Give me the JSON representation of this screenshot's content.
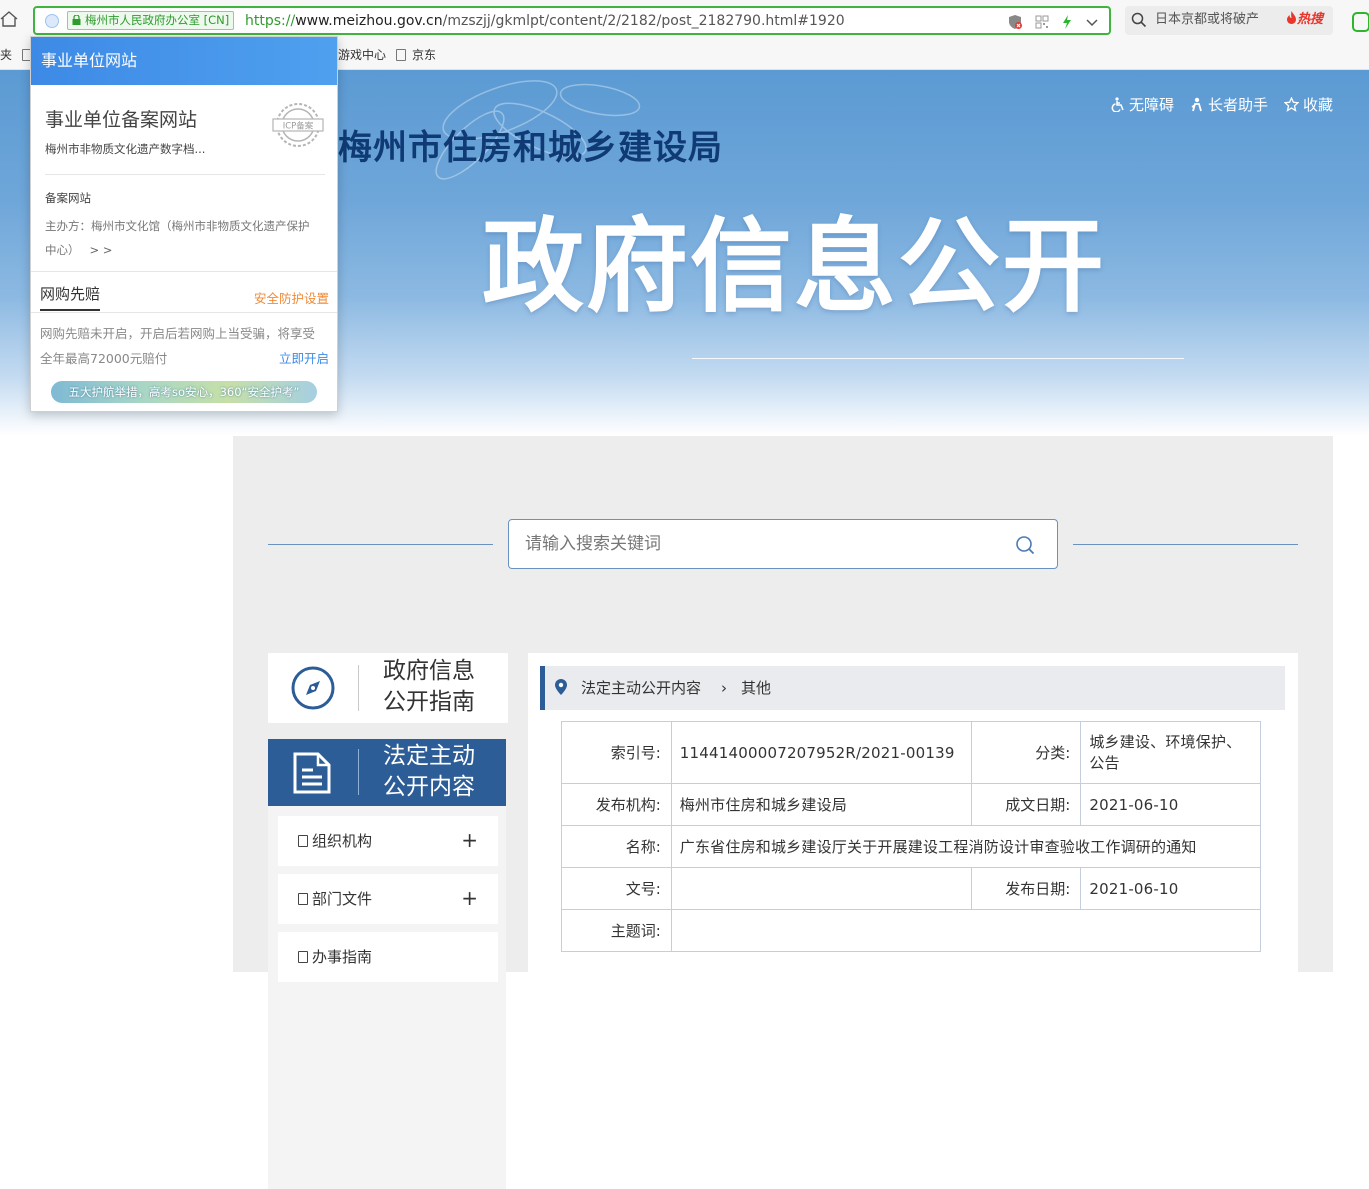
{
  "browser": {
    "address_bar": {
      "cert_label": "梅州市人民政府办公室 [CN]",
      "url_scheme": "https://",
      "url_domain": "www.meizhou.gov.cn",
      "url_path": "/mzszjj/gkmlpt/content/2/2182/post_2182790.html#1920"
    },
    "search_box": {
      "query": "日本京都或将破产",
      "hot_label": "热搜"
    },
    "bookmarks": [
      {
        "label": "夹"
      },
      {
        "label": "游戏中心"
      },
      {
        "label": "京东"
      }
    ]
  },
  "popup": {
    "header": "事业单位网站",
    "title": "事业单位备案网站",
    "subtitle": "梅州市非物质文化遗产数字档...",
    "stamp_text": "ICP备案",
    "section_label": "备案网站",
    "organizer_line1": "主办方：梅州市文化馆（梅州市非物质文化遗产保护",
    "organizer_line2": "中心）",
    "more": "> >",
    "tab_label": "网购先赔",
    "settings_link": "安全防护设置",
    "desc_line1": "网购先赔未开启，开启后若网购上当受骗，将享受",
    "desc_line2": "全年最高72000元赔付",
    "enable_link": "立即开启",
    "banner_text": "五大护航举措，高考so安心，360“安全护考”"
  },
  "hero": {
    "site_title": "梅州市住房和城乡建设局",
    "banner_title": "政府信息公开",
    "links": [
      {
        "label": "无障碍"
      },
      {
        "label": "长者助手"
      },
      {
        "label": "收藏"
      }
    ]
  },
  "search": {
    "placeholder": "请输入搜索关键词"
  },
  "sidebar": {
    "guide": {
      "line1": "政府信息",
      "line2": "公开指南"
    },
    "active": {
      "line1": "法定主动",
      "line2": "公开内容"
    },
    "items": [
      {
        "label": "组织机构",
        "toggle": "+"
      },
      {
        "label": "部门文件",
        "toggle": "+"
      },
      {
        "label": "办事指南"
      }
    ]
  },
  "breadcrumb": {
    "level1": "法定主动公开内容",
    "separator": "›",
    "level2": "其他"
  },
  "doc_info": {
    "index_no_label": "索引号:",
    "index_no": "11441400007207952R/2021-00139",
    "category_label": "分类:",
    "category_line1": "城乡建设、环境保护、",
    "category_line2": "公告",
    "publisher_label": "发布机构:",
    "publisher": "梅州市住房和城乡建设局",
    "created_label": "成文日期:",
    "created": "2021-06-10",
    "name_label": "名称:",
    "name": "广东省住房和城乡建设厅关于开展建设工程消防设计审查验收工作调研的通知",
    "doc_no_label": "文号:",
    "doc_no": "",
    "publish_date_label": "发布日期:",
    "publish_date": "2021-06-10",
    "keywords_label": "主题词:",
    "keywords": ""
  },
  "colors": {
    "brand_blue": "#2c5d97",
    "address_green": "#3fb53f",
    "popup_header": "#3e8ee8",
    "link_orange": "#f08a36"
  }
}
